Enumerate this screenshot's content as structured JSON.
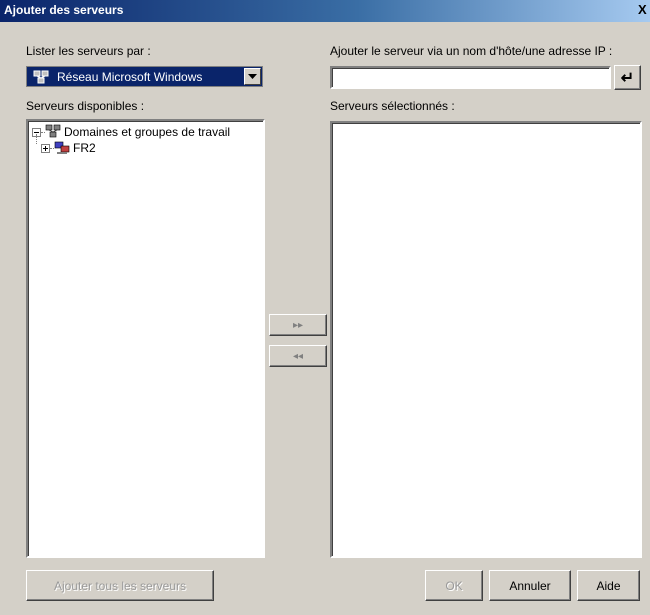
{
  "window": {
    "title": "Ajouter des serveurs",
    "close_glyph": "X"
  },
  "list_by": {
    "label": "Lister les serveurs par :",
    "selected": "Réseau Microsoft Windows",
    "icon": "network-icon"
  },
  "add_by_host": {
    "label": "Ajouter le serveur via un nom d'hôte/une adresse IP :",
    "value": "",
    "enter_glyph": "↵"
  },
  "available": {
    "label": "Serveurs disponibles :",
    "tree": [
      {
        "label": "Domaines et groupes de travail",
        "expanded": true,
        "icon": "network-icon"
      },
      {
        "label": "FR2",
        "expanded": false,
        "icon": "workgroup-icon"
      }
    ]
  },
  "selected_servers": {
    "label": "Serveurs sélectionnés :",
    "items": []
  },
  "move": {
    "add_glyph": "▸▸",
    "remove_glyph": "◂◂"
  },
  "footer": {
    "add_all": "Ajouter tous les serveurs",
    "ok": "OK",
    "cancel": "Annuler",
    "help": "Aide"
  }
}
